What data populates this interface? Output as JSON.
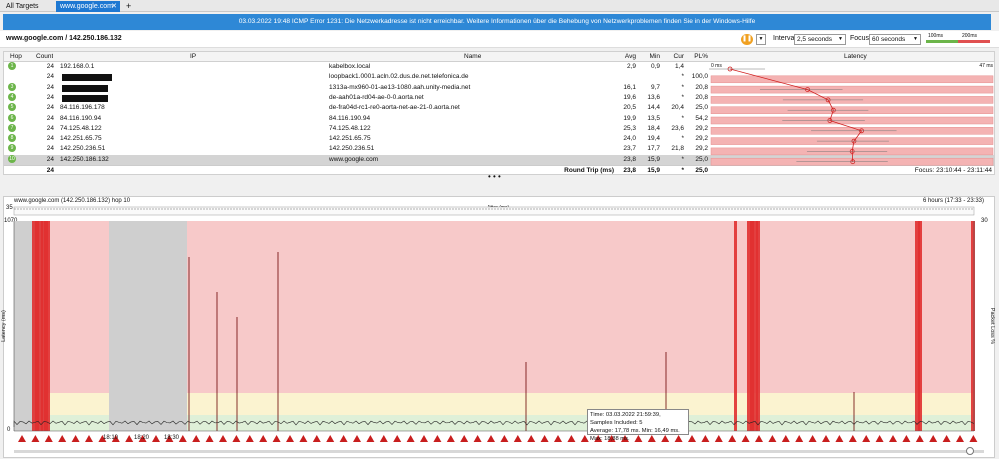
{
  "tabs": {
    "all": "All Targets",
    "active": "www.google.com",
    "add": "+"
  },
  "banner": {
    "text": "03.03.2022 19:48 ICMP Error 1231: Die Netzwerkadresse ist nicht erreichbar. Weitere Informationen über die Behebung von Netzwerkproblemen finden Sie in der Windows-Hilfe"
  },
  "toolbar": {
    "target": "www.google.com / 142.250.186.132",
    "interval_label": "Interval",
    "interval_value": "2,5 seconds",
    "focus_label": "Focus",
    "focus_value": "60 seconds",
    "legend_low": "100ms",
    "legend_high": "200ms"
  },
  "table": {
    "headers": {
      "hop": "Hop",
      "count": "Count",
      "ip": "IP",
      "name": "Name",
      "avg": "Avg",
      "min": "Min",
      "cur": "Cur",
      "pl": "PL%",
      "latency": "Latency"
    },
    "latency_scale": {
      "left": "0 ms",
      "right": "47 ms"
    },
    "rows": [
      {
        "hop": "1",
        "count": "24",
        "ip": "192.168.0.1",
        "name": "kabelbox.local",
        "avg": "2,9",
        "min": "0,9",
        "cur": "1,4",
        "pl": ""
      },
      {
        "hop": "",
        "count": "24",
        "ip": "",
        "name": "loopback1.0001.acln.02.dus.de.net.telefonica.de",
        "avg": "",
        "min": "",
        "cur": "*",
        "pl": "100,0"
      },
      {
        "hop": "3",
        "count": "24",
        "ip": "",
        "name": "1313a-mx960-01-ae13-1080.aah.unity-media.net",
        "avg": "16,1",
        "min": "9,7",
        "cur": "*",
        "pl": "20,8"
      },
      {
        "hop": "4",
        "count": "24",
        "ip": "",
        "name": "de-aah01a-rd04-ae-0-0.aorta.net",
        "avg": "19,6",
        "min": "13,6",
        "cur": "*",
        "pl": "20,8"
      },
      {
        "hop": "5",
        "count": "24",
        "ip": "84.116.196.178",
        "name": "de-fra04d-rc1-re0-aorta-net-ae-21-0.aorta.net",
        "avg": "20,5",
        "min": "14,4",
        "cur": "20,4",
        "pl": "25,0"
      },
      {
        "hop": "6",
        "count": "24",
        "ip": "84.116.190.94",
        "name": "84.116.190.94",
        "avg": "19,9",
        "min": "13,5",
        "cur": "*",
        "pl": "54,2"
      },
      {
        "hop": "7",
        "count": "24",
        "ip": "74.125.48.122",
        "name": "74.125.48.122",
        "avg": "25,3",
        "min": "18,4",
        "cur": "23,6",
        "pl": "29,2"
      },
      {
        "hop": "8",
        "count": "24",
        "ip": "142.251.65.75",
        "name": "142.251.65.75",
        "avg": "24,0",
        "min": "19,4",
        "cur": "*",
        "pl": "29,2"
      },
      {
        "hop": "9",
        "count": "24",
        "ip": "142.250.236.51",
        "name": "142.250.236.51",
        "avg": "23,7",
        "min": "17,7",
        "cur": "21,8",
        "pl": "29,2"
      },
      {
        "hop": "10",
        "count": "24",
        "ip": "142.250.186.132",
        "name": "www.google.com",
        "avg": "23,8",
        "min": "15,9",
        "cur": "*",
        "pl": "25,0"
      }
    ],
    "footer": {
      "count": "24",
      "label": "Round Trip (ms)",
      "avg": "23,8",
      "min": "15,9",
      "cur": "*",
      "pl": "25,0",
      "focus": "Focus: 23:10:44 - 23:11:44"
    }
  },
  "graph": {
    "title": "www.google.com (142.250.186.132) hop 10",
    "timespan": "6 hours (17:33 - 23:33)",
    "jitter_label": "Jitter (ms)",
    "jitter_max": "35",
    "latency_max": "1070",
    "latency_zero": "0",
    "ylabel": "Latency (ms)",
    "y2label": "Packet Loss %",
    "y2_max": "30",
    "time_labels": [
      "18:10",
      "18:20",
      "18:30"
    ]
  },
  "tooltip": {
    "time": "Time: 03.03.2022 21:59:39,",
    "samples": "Samples Included: 5",
    "stats": "Average: 17,78 ms. Min: 16,49 ms. Max: 18,88 ms."
  },
  "colors": {
    "accent": "#1e78d2",
    "banner": "#2e88d6",
    "loss_red": "#f8c8c8",
    "ok_green": "#dff0d8",
    "warn_yellow": "#fbf3d0"
  }
}
